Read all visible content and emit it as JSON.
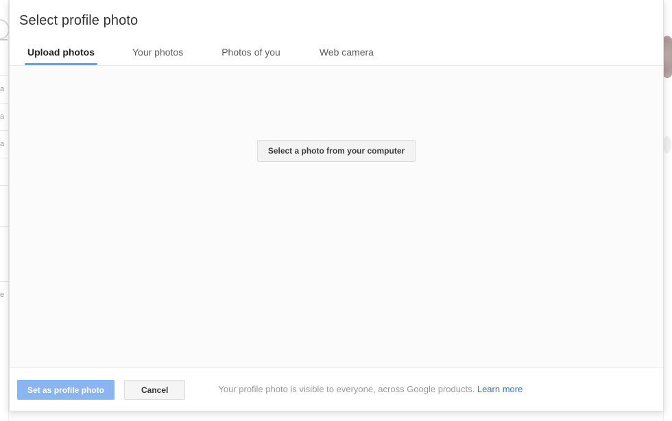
{
  "dialog": {
    "title": "Select profile photo",
    "tabs": [
      {
        "label": "Upload photos",
        "active": true
      },
      {
        "label": "Your photos",
        "active": false
      },
      {
        "label": "Photos of you",
        "active": false
      },
      {
        "label": "Web camera",
        "active": false
      }
    ],
    "body": {
      "pick_button_label": "Select a photo from your computer"
    },
    "footer": {
      "primary_label": "Set as profile photo",
      "cancel_label": "Cancel",
      "note_text": "Your profile photo is visible to everyone, across Google products.",
      "note_link_label": "Learn more"
    }
  },
  "background": {
    "left_fragments": [
      "a",
      "a",
      "a",
      "e"
    ]
  },
  "colors": {
    "accent_underline": "#6f9ee0",
    "primary_button": "#8cb4f0",
    "link": "#3b6fc4",
    "title_text": "#333333",
    "muted_text": "#9a9a9a",
    "body_background": "#fbfbfb"
  }
}
